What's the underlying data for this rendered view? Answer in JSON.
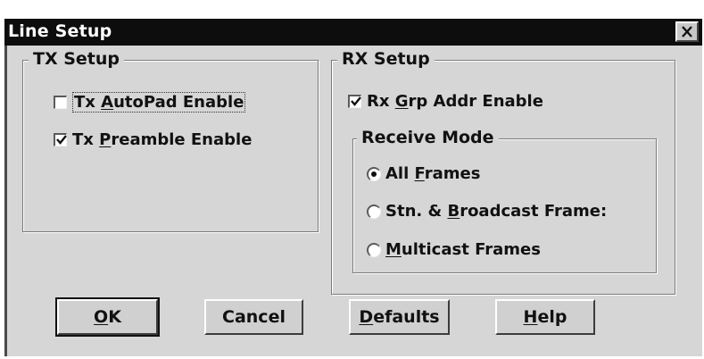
{
  "window": {
    "title": "Line Setup"
  },
  "tx_setup": {
    "label": "TX Setup",
    "autopad": {
      "pre": "Tx ",
      "mnemonic": "A",
      "post": "utoPad Enable",
      "checked": false
    },
    "preamble": {
      "pre": "Tx ",
      "mnemonic": "P",
      "post": "reamble Enable",
      "checked": true
    }
  },
  "rx_setup": {
    "label": "RX Setup",
    "grp_addr": {
      "pre": "Rx ",
      "mnemonic": "G",
      "post": "rp Addr Enable",
      "checked": true
    },
    "receive_mode": {
      "label": "Receive Mode",
      "all_frames": {
        "pre": "All ",
        "mnemonic": "F",
        "post": "rames",
        "selected": true
      },
      "stn_broadcast": {
        "pre": "Stn. & ",
        "mnemonic": "B",
        "post": "roadcast Frame:",
        "selected": false
      },
      "multicast": {
        "pre": "",
        "mnemonic": "M",
        "post": "ulticast Frames",
        "selected": false
      }
    }
  },
  "buttons": {
    "ok": {
      "pre": "",
      "mnemonic": "O",
      "post": "K"
    },
    "cancel": {
      "pre": "",
      "mnemonic": "",
      "post": "Cancel"
    },
    "defaults": {
      "pre": "",
      "mnemonic": "D",
      "post": "efaults"
    },
    "help": {
      "pre": "",
      "mnemonic": "H",
      "post": "elp"
    }
  },
  "icons": {
    "close": "close-icon",
    "check": "checkmark-icon",
    "radio": "radio-dot-icon"
  },
  "colors": {
    "titlebar": "#0d0d0d",
    "face": "#d6d6d6",
    "text": "#111111"
  }
}
